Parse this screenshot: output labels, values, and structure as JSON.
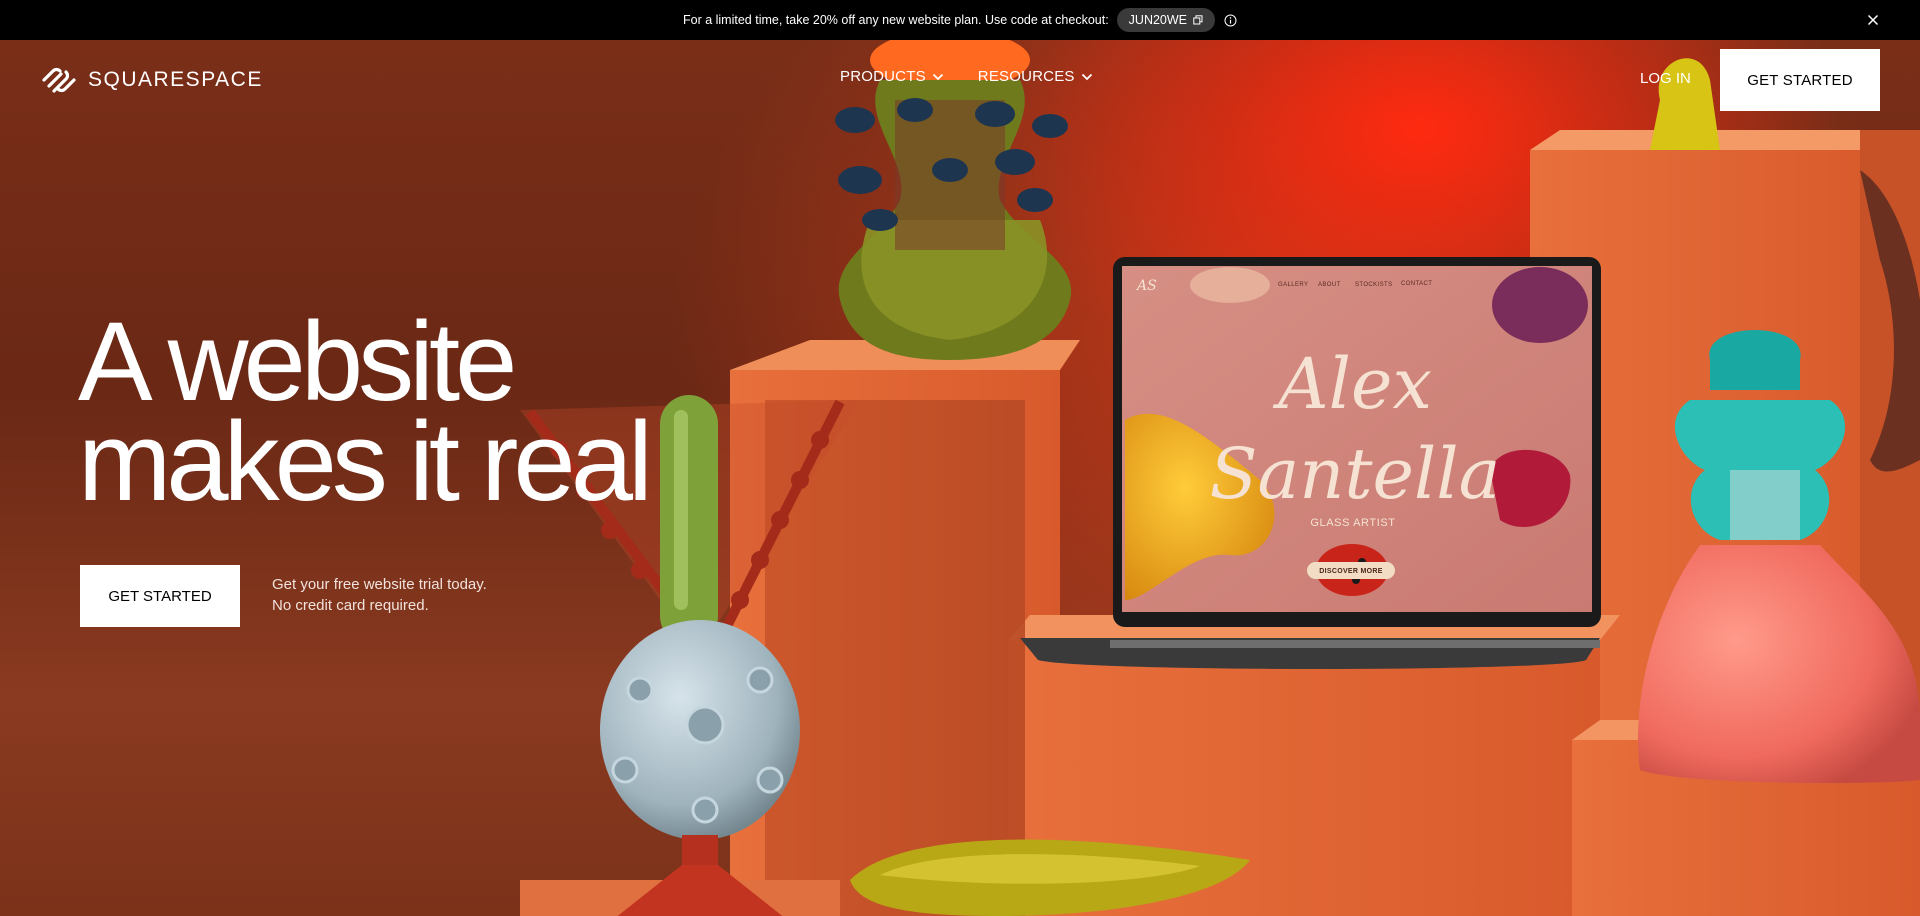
{
  "promo": {
    "text": "For a limited time, take 20% off any new website plan. Use code at checkout:",
    "code": "JUN20WE"
  },
  "header": {
    "logo_text": "SQUARESPACE",
    "nav": [
      {
        "label": "PRODUCTS"
      },
      {
        "label": "RESOURCES"
      }
    ],
    "login_label": "LOG IN",
    "cta_label": "GET STARTED"
  },
  "hero": {
    "headline_line1": "A website",
    "headline_line2": "makes it real",
    "cta_label": "GET STARTED",
    "sub_line1": "Get your free website trial today.",
    "sub_line2": "No credit card required."
  },
  "laptop_site": {
    "monogram": "AS",
    "nav": [
      "GALLERY",
      "ABOUT",
      "STOCKISTS",
      "CONTACT"
    ],
    "name_line1": "Alex",
    "name_line2": "Santella",
    "role": "GLASS ARTIST",
    "button": "DISCOVER MORE"
  },
  "colors": {
    "promo_bg": "#000000",
    "hero_bg": "#6a2815",
    "accent_red": "#ff2a10",
    "pedestal_orange": "#e86a3a"
  }
}
